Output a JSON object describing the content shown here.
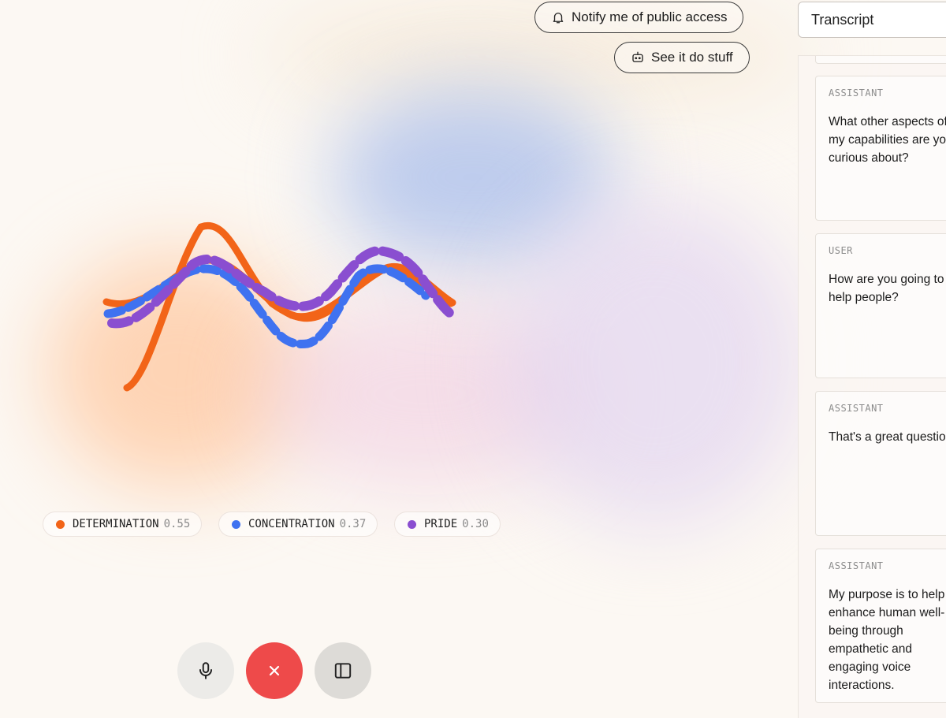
{
  "header": {
    "notify_label": "Notify me of public access",
    "see_label": "See it do stuff"
  },
  "emotions": [
    {
      "name": "DETERMINATION",
      "score": "0.55",
      "color": "#f26418"
    },
    {
      "name": "CONCENTRATION",
      "score": "0.37",
      "color": "#3f72f0"
    },
    {
      "name": "PRIDE",
      "score": "0.30",
      "color": "#8a4ed0"
    }
  ],
  "transcript": {
    "select_label": "Transcript",
    "messages": [
      {
        "role": "ASSISTANT",
        "lines": [
          "What other aspects of",
          "my capabilities are you",
          "curious about?"
        ]
      },
      {
        "role": "USER",
        "lines": [
          "How are you going to",
          "help people?"
        ]
      },
      {
        "role": "ASSISTANT",
        "lines": [
          "That's a great question"
        ]
      },
      {
        "role": "ASSISTANT",
        "lines": [
          "My purpose is to help",
          "enhance human well-",
          "being through",
          "empathetic and",
          "engaging voice",
          "interactions."
        ]
      }
    ]
  },
  "controls": {
    "mic_icon": "microphone-icon",
    "end_icon": "close-icon",
    "panel_icon": "sidebar-icon",
    "end_color": "#ee4a4a"
  }
}
